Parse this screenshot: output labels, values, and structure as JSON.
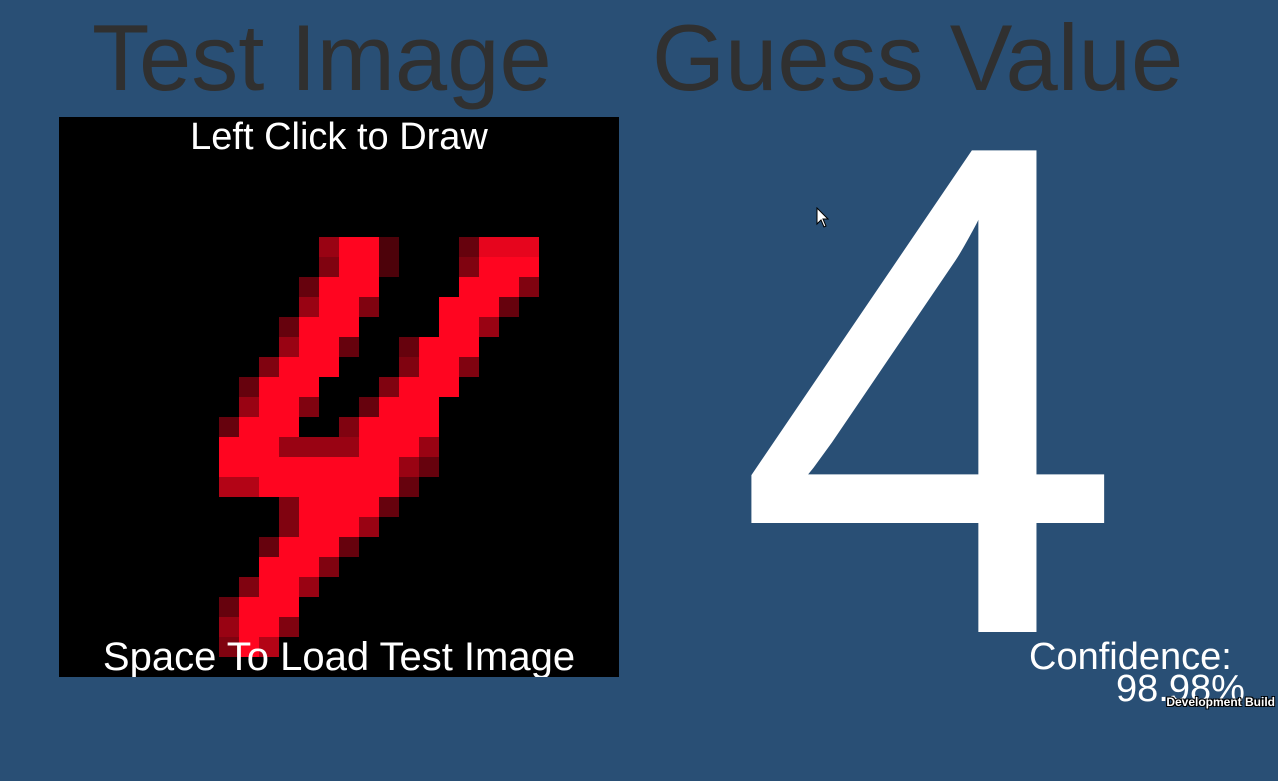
{
  "headings": {
    "test_image": "Test Image",
    "guess_value": "Guess Value"
  },
  "canvas": {
    "top_caption": "Left Click to Draw",
    "bottom_caption": "Space To Load Test Image",
    "grid_size": 28,
    "stroke_color": "#ff0520",
    "background_color": "#000000"
  },
  "guess": {
    "digit": "4"
  },
  "confidence": {
    "label": "Confidence:",
    "value": "98.98%"
  },
  "footer": {
    "build_label": "Development Build"
  },
  "colors": {
    "background": "#294f75",
    "heading_text": "#303030",
    "overlay_text": "#ffffff"
  }
}
